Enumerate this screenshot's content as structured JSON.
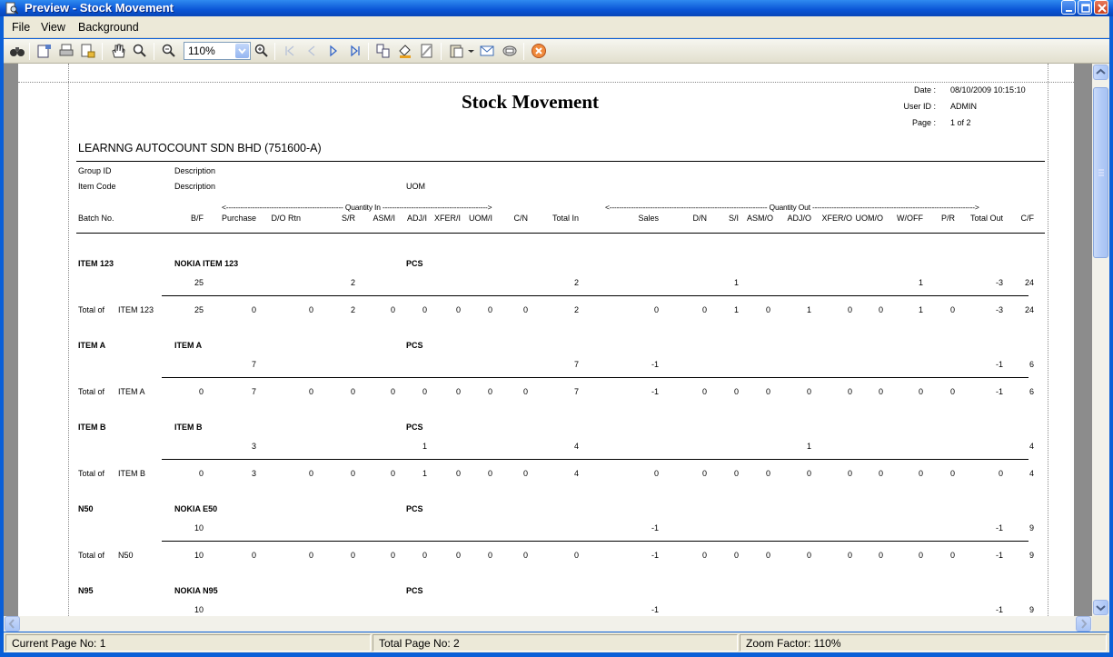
{
  "window": {
    "title": "Preview - Stock Movement"
  },
  "menu": [
    "File",
    "View",
    "Background"
  ],
  "toolbar": {
    "zoom": "110%"
  },
  "report": {
    "title": "Stock Movement",
    "date_label": "Date :",
    "date": "08/10/2009 10:15:10",
    "user_label": "User ID :",
    "user": "ADMIN",
    "page_label": "Page :",
    "page": "1 of 2",
    "company": "LEARNNG AUTOCOUNT SDN BHD (751600-A)",
    "hdr": {
      "group_id": "Group ID",
      "description": "Description",
      "item_code": "Item Code",
      "description2": "Description",
      "uom": "UOM",
      "qty_in": "<------------------------------------------------- Quantity In -------------------------------------------->",
      "qty_out": "<------------------------------------------------------------------ Quantity Out -------------------------------------------------------------------->",
      "batch": "Batch No.",
      "cols": [
        "B/F",
        "Purchase",
        "D/O Rtn",
        "S/R",
        "ASM/I",
        "ADJ/I",
        "XFER/I",
        "UOM/I",
        "C/N",
        "Total In",
        "Sales",
        "D/N",
        "S/I",
        "ASM/O",
        "ADJ/O",
        "XFER/O",
        "UOM/O",
        "W/OFF",
        "P/R",
        "Total Out",
        "C/F"
      ]
    },
    "total_of": "Total of",
    "items": [
      {
        "code": "ITEM 123",
        "desc": "NOKIA ITEM 123",
        "uom": "PCS",
        "detail": [
          "25",
          "",
          "",
          "2",
          "",
          "",
          "",
          "",
          "",
          "2",
          "",
          "",
          "1",
          "",
          "",
          "",
          "",
          "1",
          "",
          "-3",
          "24"
        ],
        "total": [
          "25",
          "0",
          "0",
          "2",
          "0",
          "0",
          "0",
          "0",
          "0",
          "2",
          "0",
          "0",
          "1",
          "0",
          "1",
          "0",
          "0",
          "1",
          "0",
          "-3",
          "24"
        ]
      },
      {
        "code": "ITEM A",
        "desc": "ITEM A",
        "uom": "PCS",
        "detail": [
          "",
          "7",
          "",
          "",
          "",
          "",
          "",
          "",
          "",
          "7",
          "-1",
          "",
          "",
          "",
          "",
          "",
          "",
          "",
          "",
          "-1",
          "6"
        ],
        "total": [
          "0",
          "7",
          "0",
          "0",
          "0",
          "0",
          "0",
          "0",
          "0",
          "7",
          "-1",
          "0",
          "0",
          "0",
          "0",
          "0",
          "0",
          "0",
          "0",
          "-1",
          "6"
        ]
      },
      {
        "code": "ITEM B",
        "desc": "ITEM B",
        "uom": "PCS",
        "detail": [
          "",
          "3",
          "",
          "",
          "",
          "1",
          "",
          "",
          "",
          "4",
          "",
          "",
          "",
          "",
          "1",
          "",
          "",
          "",
          "",
          "",
          "4"
        ],
        "total": [
          "0",
          "3",
          "0",
          "0",
          "0",
          "1",
          "0",
          "0",
          "0",
          "4",
          "0",
          "0",
          "0",
          "0",
          "0",
          "0",
          "0",
          "0",
          "0",
          "0",
          "4"
        ]
      },
      {
        "code": "N50",
        "desc": "NOKIA E50",
        "uom": "PCS",
        "detail": [
          "10",
          "",
          "",
          "",
          "",
          "",
          "",
          "",
          "",
          "",
          "-1",
          "",
          "",
          "",
          "",
          "",
          "",
          "",
          "",
          "-1",
          "9"
        ],
        "total": [
          "10",
          "0",
          "0",
          "0",
          "0",
          "0",
          "0",
          "0",
          "0",
          "0",
          "-1",
          "0",
          "0",
          "0",
          "0",
          "0",
          "0",
          "0",
          "0",
          "-1",
          "9"
        ]
      },
      {
        "code": "N95",
        "desc": "NOKIA N95",
        "uom": "PCS",
        "detail": [
          "10",
          "",
          "",
          "",
          "",
          "",
          "",
          "",
          "",
          "",
          "-1",
          "",
          "",
          "",
          "",
          "",
          "",
          "",
          "",
          "-1",
          "9"
        ]
      }
    ]
  },
  "status": {
    "current_page": "Current Page No: 1",
    "total_pages": "Total Page No: 2",
    "zoom_factor": "Zoom Factor: 110%"
  },
  "colors": {
    "title_bar": "#0a55d6",
    "chrome": "#ece9d8",
    "viewport": "#8c8c8c"
  }
}
